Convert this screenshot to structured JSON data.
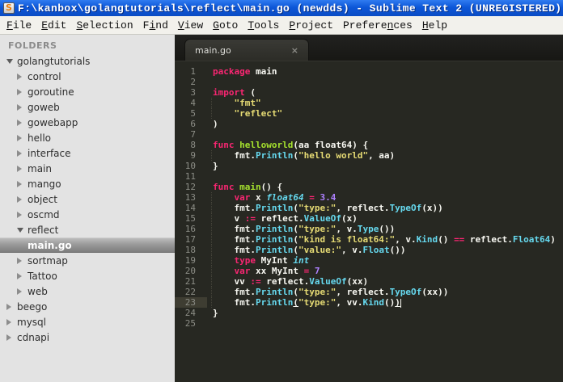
{
  "window": {
    "title": "F:\\kanbox\\golangtutorials\\reflect\\main.go (newdds) - Sublime Text 2 (UNREGISTERED)",
    "app_icon_letter": "S"
  },
  "menubar": {
    "items": [
      {
        "label": "File",
        "underline": 0
      },
      {
        "label": "Edit",
        "underline": 0
      },
      {
        "label": "Selection",
        "underline": 0
      },
      {
        "label": "Find",
        "underline": 1
      },
      {
        "label": "View",
        "underline": 0
      },
      {
        "label": "Goto",
        "underline": 0
      },
      {
        "label": "Tools",
        "underline": 0
      },
      {
        "label": "Project",
        "underline": 0
      },
      {
        "label": "Preferences",
        "underline": 7
      },
      {
        "label": "Help",
        "underline": 0
      }
    ]
  },
  "sidebar": {
    "header": "FOLDERS",
    "items": [
      {
        "label": "golangtutorials",
        "level": 0,
        "type": "folder",
        "state": "expanded",
        "selected": false
      },
      {
        "label": "control",
        "level": 1,
        "type": "folder",
        "state": "collapsed",
        "selected": false
      },
      {
        "label": "goroutine",
        "level": 1,
        "type": "folder",
        "state": "collapsed",
        "selected": false
      },
      {
        "label": "goweb",
        "level": 1,
        "type": "folder",
        "state": "collapsed",
        "selected": false
      },
      {
        "label": "gowebapp",
        "level": 1,
        "type": "folder",
        "state": "collapsed",
        "selected": false
      },
      {
        "label": "hello",
        "level": 1,
        "type": "folder",
        "state": "collapsed",
        "selected": false
      },
      {
        "label": "interface",
        "level": 1,
        "type": "folder",
        "state": "collapsed",
        "selected": false
      },
      {
        "label": "main",
        "level": 1,
        "type": "folder",
        "state": "collapsed",
        "selected": false
      },
      {
        "label": "mango",
        "level": 1,
        "type": "folder",
        "state": "collapsed",
        "selected": false
      },
      {
        "label": "object",
        "level": 1,
        "type": "folder",
        "state": "collapsed",
        "selected": false
      },
      {
        "label": "oscmd",
        "level": 1,
        "type": "folder",
        "state": "collapsed",
        "selected": false
      },
      {
        "label": "reflect",
        "level": 1,
        "type": "folder",
        "state": "expanded",
        "selected": false
      },
      {
        "label": "main.go",
        "level": 2,
        "type": "file",
        "state": "none",
        "selected": true
      },
      {
        "label": "sortmap",
        "level": 1,
        "type": "folder",
        "state": "collapsed",
        "selected": false
      },
      {
        "label": "Tattoo",
        "level": 1,
        "type": "folder",
        "state": "collapsed",
        "selected": false
      },
      {
        "label": "web",
        "level": 1,
        "type": "folder",
        "state": "collapsed",
        "selected": false
      },
      {
        "label": "beego",
        "level": 0,
        "type": "folder",
        "state": "collapsed",
        "selected": false
      },
      {
        "label": "mysql",
        "level": 0,
        "type": "folder",
        "state": "collapsed",
        "selected": false
      },
      {
        "label": "cdnapi",
        "level": 0,
        "type": "folder",
        "state": "collapsed",
        "selected": false
      }
    ]
  },
  "editor": {
    "tab": {
      "label": "main.go",
      "close_icon": "×"
    },
    "language": "go",
    "current_line": 23,
    "total_lines": 25,
    "lines": [
      {
        "num": 1,
        "guide": false,
        "current": false,
        "segments": [
          [
            "k",
            "package "
          ],
          [
            "p",
            "main"
          ]
        ]
      },
      {
        "num": 2,
        "guide": false,
        "current": false,
        "segments": []
      },
      {
        "num": 3,
        "guide": false,
        "current": false,
        "segments": [
          [
            "k",
            "import "
          ],
          [
            "p",
            "("
          ]
        ]
      },
      {
        "num": 4,
        "guide": true,
        "current": false,
        "segments": [
          [
            "p",
            "    "
          ],
          [
            "s",
            "\"fmt\""
          ]
        ]
      },
      {
        "num": 5,
        "guide": true,
        "current": false,
        "segments": [
          [
            "p",
            "    "
          ],
          [
            "s",
            "\"reflect\""
          ]
        ]
      },
      {
        "num": 6,
        "guide": false,
        "current": false,
        "segments": [
          [
            "p",
            ")"
          ]
        ]
      },
      {
        "num": 7,
        "guide": false,
        "current": false,
        "segments": []
      },
      {
        "num": 8,
        "guide": false,
        "current": false,
        "segments": [
          [
            "k",
            "func "
          ],
          [
            "f",
            "helloworld"
          ],
          [
            "p",
            "(aa float64) {"
          ]
        ]
      },
      {
        "num": 9,
        "guide": true,
        "current": false,
        "segments": [
          [
            "p",
            "    fmt."
          ],
          [
            "m",
            "Println"
          ],
          [
            "p",
            "("
          ],
          [
            "s",
            "\"hello world\""
          ],
          [
            "p",
            ", aa)"
          ]
        ]
      },
      {
        "num": 10,
        "guide": false,
        "current": false,
        "segments": [
          [
            "p",
            "}"
          ]
        ]
      },
      {
        "num": 11,
        "guide": false,
        "current": false,
        "segments": []
      },
      {
        "num": 12,
        "guide": false,
        "current": false,
        "segments": [
          [
            "k",
            "func "
          ],
          [
            "f",
            "main"
          ],
          [
            "p",
            "() {"
          ]
        ]
      },
      {
        "num": 13,
        "guide": true,
        "current": false,
        "segments": [
          [
            "p",
            "    "
          ],
          [
            "k",
            "var "
          ],
          [
            "p",
            "x "
          ],
          [
            "t",
            "float64"
          ],
          [
            "p",
            " "
          ],
          [
            "k",
            "="
          ],
          [
            "p",
            " "
          ],
          [
            "n",
            "3.4"
          ]
        ]
      },
      {
        "num": 14,
        "guide": true,
        "current": false,
        "segments": [
          [
            "p",
            "    fmt."
          ],
          [
            "m",
            "Println"
          ],
          [
            "p",
            "("
          ],
          [
            "s",
            "\"type:\""
          ],
          [
            "p",
            ", reflect."
          ],
          [
            "m",
            "TypeOf"
          ],
          [
            "p",
            "(x))"
          ]
        ]
      },
      {
        "num": 15,
        "guide": true,
        "current": false,
        "segments": [
          [
            "p",
            "    v "
          ],
          [
            "k",
            ":="
          ],
          [
            "p",
            " reflect."
          ],
          [
            "m",
            "ValueOf"
          ],
          [
            "p",
            "(x)"
          ]
        ]
      },
      {
        "num": 16,
        "guide": true,
        "current": false,
        "segments": [
          [
            "p",
            "    fmt."
          ],
          [
            "m",
            "Println"
          ],
          [
            "p",
            "("
          ],
          [
            "s",
            "\"type:\""
          ],
          [
            "p",
            ", v."
          ],
          [
            "m",
            "Type"
          ],
          [
            "p",
            "())"
          ]
        ]
      },
      {
        "num": 17,
        "guide": true,
        "current": false,
        "segments": [
          [
            "p",
            "    fmt."
          ],
          [
            "m",
            "Println"
          ],
          [
            "p",
            "("
          ],
          [
            "s",
            "\"kind is float64:\""
          ],
          [
            "p",
            ", v."
          ],
          [
            "m",
            "Kind"
          ],
          [
            "p",
            "() "
          ],
          [
            "k",
            "=="
          ],
          [
            "p",
            " reflect."
          ],
          [
            "m",
            "Float64"
          ],
          [
            "p",
            ")"
          ]
        ]
      },
      {
        "num": 18,
        "guide": true,
        "current": false,
        "segments": [
          [
            "p",
            "    fmt."
          ],
          [
            "m",
            "Println"
          ],
          [
            "p",
            "("
          ],
          [
            "s",
            "\"value:\""
          ],
          [
            "p",
            ", v."
          ],
          [
            "m",
            "Float"
          ],
          [
            "p",
            "())"
          ]
        ]
      },
      {
        "num": 19,
        "guide": true,
        "current": false,
        "segments": [
          [
            "p",
            "    "
          ],
          [
            "k",
            "type "
          ],
          [
            "p",
            "MyInt "
          ],
          [
            "t",
            "int"
          ]
        ]
      },
      {
        "num": 20,
        "guide": true,
        "current": false,
        "segments": [
          [
            "p",
            "    "
          ],
          [
            "k",
            "var "
          ],
          [
            "p",
            "xx MyInt "
          ],
          [
            "k",
            "="
          ],
          [
            "p",
            " "
          ],
          [
            "n",
            "7"
          ]
        ]
      },
      {
        "num": 21,
        "guide": true,
        "current": false,
        "segments": [
          [
            "p",
            "    vv "
          ],
          [
            "k",
            ":="
          ],
          [
            "p",
            " reflect."
          ],
          [
            "m",
            "ValueOf"
          ],
          [
            "p",
            "(xx)"
          ]
        ]
      },
      {
        "num": 22,
        "guide": true,
        "current": false,
        "segments": [
          [
            "p",
            "    fmt."
          ],
          [
            "m",
            "Println"
          ],
          [
            "p",
            "("
          ],
          [
            "s",
            "\"type:\""
          ],
          [
            "p",
            ", reflect."
          ],
          [
            "m",
            "TypeOf"
          ],
          [
            "p",
            "(xx))"
          ]
        ]
      },
      {
        "num": 23,
        "guide": true,
        "current": true,
        "segments": [
          [
            "p",
            "    fmt."
          ],
          [
            "m",
            "Println"
          ],
          [
            "u",
            "("
          ],
          [
            "s",
            "\"type:\""
          ],
          [
            "p",
            ", vv."
          ],
          [
            "m",
            "Kind"
          ],
          [
            "p",
            "()"
          ],
          [
            "u",
            ")"
          ],
          [
            "cur",
            ""
          ]
        ]
      },
      {
        "num": 24,
        "guide": false,
        "current": false,
        "segments": [
          [
            "p",
            "}"
          ]
        ]
      },
      {
        "num": 25,
        "guide": false,
        "current": false,
        "segments": []
      }
    ]
  },
  "colors": {
    "titlebar_blue": "#0d57d8",
    "menubar_bg": "#f2f1ec",
    "sidebar_bg": "#e3e3e3",
    "sidebar_selected_top": "#bcbcbc",
    "sidebar_selected_bottom": "#7d7d7d",
    "editor_bg": "#272822",
    "tabbar_bg": "#1a1a16",
    "keyword_pink": "#f92672",
    "function_green": "#a6e22e",
    "string_yellow": "#e6db74",
    "type_cyan": "#66d9ef",
    "number_purple": "#ae81ff",
    "plain_fg": "#f8f8f2",
    "line_number_fg": "#8c8d86",
    "current_line_gutter": "#3e3d32"
  }
}
